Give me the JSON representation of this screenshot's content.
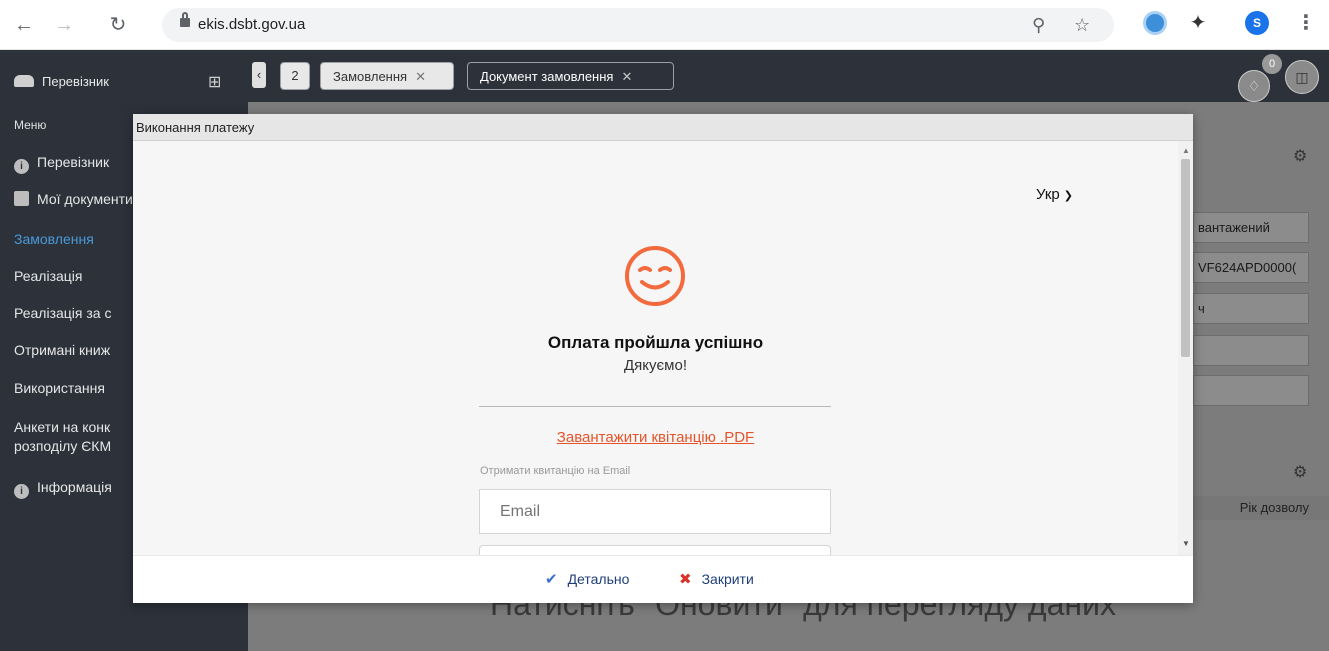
{
  "browser": {
    "url": "ekis.dsbt.gov.ua",
    "profile_initial": "S"
  },
  "app": {
    "brand": "Перевізник",
    "menu_label": "Меню",
    "sidebar_items": [
      {
        "label": "Перевізник",
        "icon": "info-icon"
      },
      {
        "label": "Мої документи",
        "icon": "briefcase-icon"
      },
      {
        "label": "Замовлення",
        "active": true
      },
      {
        "label": "Реалізація"
      },
      {
        "label": "Реалізація за с"
      },
      {
        "label": "Отримані книж"
      },
      {
        "label": "Використання"
      },
      {
        "label": "Анкети на конк"
      },
      {
        "label": "розподілу ЄКМ"
      },
      {
        "label": "Інформація",
        "icon": "info-icon"
      }
    ],
    "tab_count": "2",
    "tabs": [
      {
        "label": "Замовлення",
        "active": false
      },
      {
        "label": "Документ замовлення",
        "active": true
      }
    ],
    "notifications_count": "0",
    "background": {
      "field_1": "вантажений",
      "field_2": "VF624APD0000(",
      "field_3": "ч",
      "column_header": "Рік дозволу",
      "hint": "Натисніть \"Оновити\" для перегляду даних"
    }
  },
  "modal": {
    "title": "Виконання платежу",
    "language": "Укр",
    "success_title": "Оплата пройшла успішно",
    "thanks": "Дякуємо!",
    "pdf_link": "Завантажити квітанцію .PDF",
    "email_label": "Отримати квитанцію на Email",
    "email_placeholder": "Email",
    "footer": {
      "details_label": "Детально",
      "close_label": "Закрити"
    },
    "accent_color": "#e4542a"
  }
}
